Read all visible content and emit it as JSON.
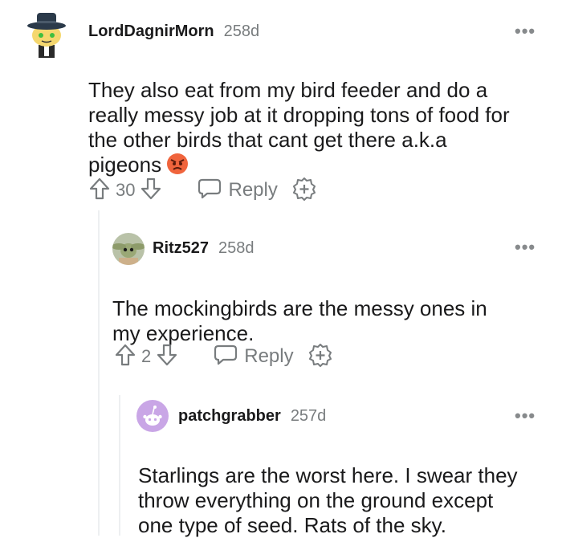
{
  "comments": [
    {
      "username": "LordDagnirMorn",
      "age": "258d",
      "body": "They also eat from my bird feeder and do a\nreally messy job at it dropping tons of food for\nthe other birds that cant get there a.k.a\npigeons",
      "emoji": "angry-face",
      "votes": "30",
      "reply_label": "Reply"
    },
    {
      "username": "Ritz527",
      "age": "258d",
      "body": "The mockingbirds are the messy ones in\nmy experience.",
      "votes": "2",
      "reply_label": "Reply"
    },
    {
      "username": "patchgrabber",
      "age": "257d",
      "body": "Starlings are the worst here. I swear they\nthrow everything on the ground except\none type of seed. Rats of the sky."
    }
  ],
  "more_icon": "•••",
  "colors": {
    "text": "#1a1a1b",
    "muted": "#787c7e",
    "thread_line": "#edeff1",
    "snoo_purple": "#c9a6e6"
  }
}
